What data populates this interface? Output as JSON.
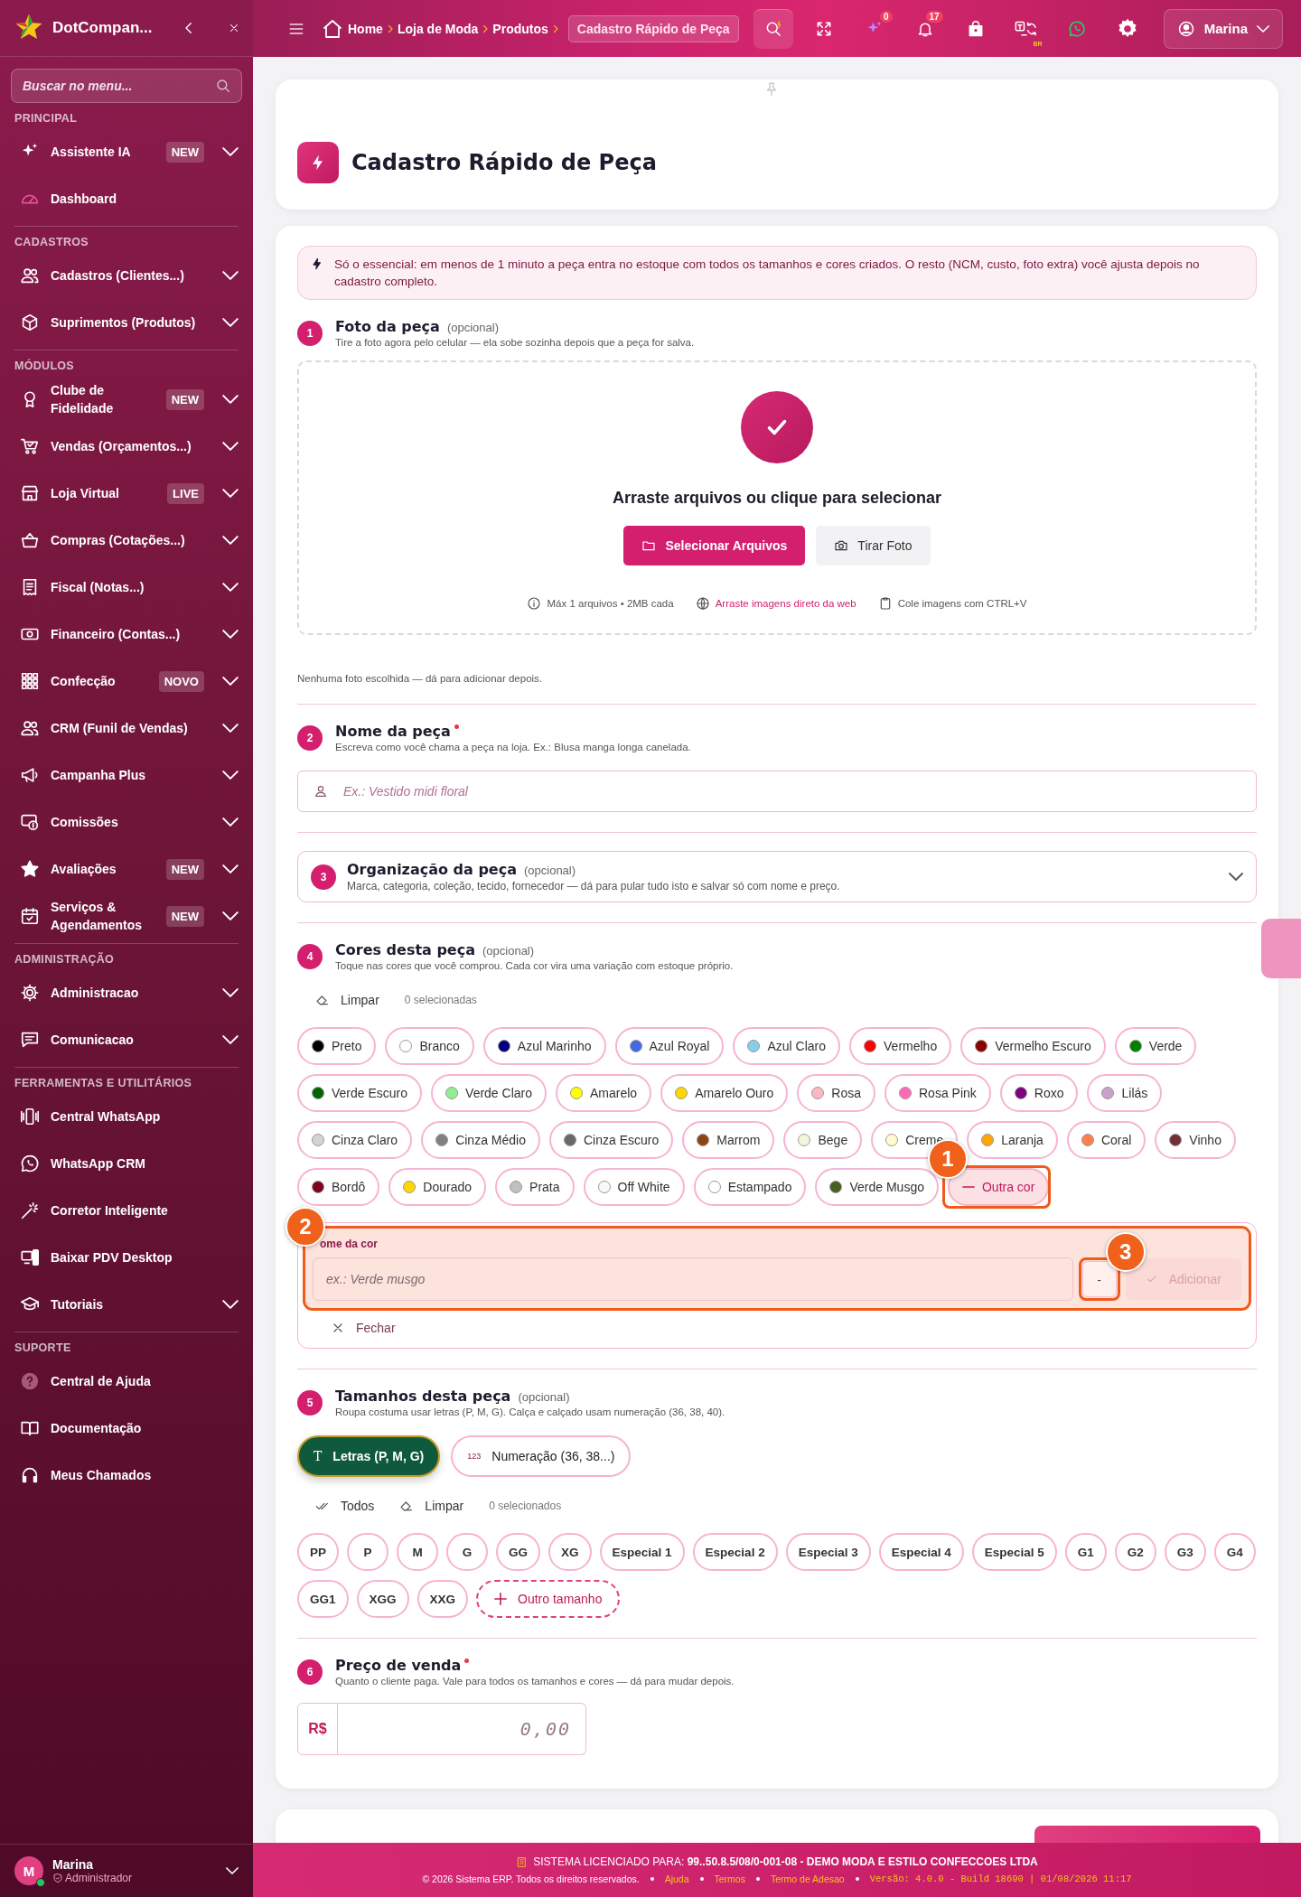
{
  "sidebar": {
    "brand": "DotCompan...",
    "search": {
      "placeholder": "Buscar no menu..."
    },
    "sections": [
      {
        "title": "PRINCIPAL",
        "items": [
          {
            "label": "Assistente IA",
            "badge": "NEW",
            "expandable": true
          },
          {
            "label": "Dashboard",
            "expandable": false
          }
        ]
      },
      {
        "title": "CADASTROS",
        "items": [
          {
            "label": "Cadastros (Clientes...)",
            "expandable": true
          },
          {
            "label": "Suprimentos (Produtos)",
            "expandable": true
          }
        ]
      },
      {
        "title": "MÓDULOS",
        "items": [
          {
            "label": "Clube de Fidelidade",
            "badge": "NEW",
            "expandable": true
          },
          {
            "label": "Vendas (Orçamentos...)",
            "expandable": true
          },
          {
            "label": "Loja Virtual",
            "badge": "LIVE",
            "expandable": true
          },
          {
            "label": "Compras (Cotações...)",
            "expandable": true
          },
          {
            "label": "Fiscal (Notas...)",
            "expandable": true
          },
          {
            "label": "Financeiro (Contas...)",
            "expandable": true
          },
          {
            "label": "Confecção",
            "badge": "NOVO",
            "expandable": true
          },
          {
            "label": "CRM (Funil de Vendas)",
            "expandable": true
          },
          {
            "label": "Campanha Plus",
            "expandable": true
          },
          {
            "label": "Comissões",
            "expandable": true
          },
          {
            "label": "Avaliações",
            "badge": "NEW",
            "expandable": true
          },
          {
            "label": "Serviços & Agendamentos",
            "badge": "NEW",
            "expandable": true
          }
        ]
      },
      {
        "title": "ADMINISTRAÇÃO",
        "items": [
          {
            "label": "Administracao",
            "expandable": true
          },
          {
            "label": "Comunicacao",
            "expandable": true
          }
        ]
      },
      {
        "title": "FERRAMENTAS E UTILITÁRIOS",
        "items": [
          {
            "label": "Central WhatsApp",
            "expandable": false
          },
          {
            "label": "WhatsApp CRM",
            "expandable": false
          },
          {
            "label": "Corretor Inteligente",
            "expandable": false
          },
          {
            "label": "Baixar PDV Desktop",
            "expandable": false
          },
          {
            "label": "Tutoriais",
            "expandable": true
          }
        ]
      },
      {
        "title": "SUPORTE",
        "items": [
          {
            "label": "Central de Ajuda",
            "expandable": false
          },
          {
            "label": "Documentação",
            "expandable": false
          },
          {
            "label": "Meus Chamados",
            "expandable": false
          }
        ]
      }
    ],
    "user": {
      "initial": "M",
      "name": "Marina",
      "role": "Administrador",
      "online": true
    }
  },
  "topbar": {
    "breadcrumb": [
      {
        "label": "Home",
        "current": false
      },
      {
        "label": "Loja de Moda",
        "current": false
      },
      {
        "label": "Produtos",
        "current": false
      },
      {
        "label": "Cadastro Rápido de Peça",
        "current": true
      }
    ],
    "tools": [
      {
        "kind": "search"
      },
      {
        "kind": "expand"
      },
      {
        "kind": "ai",
        "badge": "0"
      },
      {
        "kind": "bell",
        "badge": "17"
      },
      {
        "kind": "bag"
      },
      {
        "kind": "translate",
        "tag": "BR"
      },
      {
        "kind": "whatsapp"
      },
      {
        "kind": "settings"
      }
    ],
    "user": "Marina"
  },
  "page": {
    "title": "Cadastro Rápido de Peça"
  },
  "form": {
    "notice": "Só o essencial: em menos de 1 minuto a peça entra no estoque com todos os tamanhos e cores criados. O resto (NCM, custo, foto extra) você ajusta depois no cadastro completo.",
    "steps": [
      {
        "kind": "photo",
        "number": "1",
        "title": "Foto da peça",
        "note": "(opcional)",
        "description": "Tire a foto agora pelo celular — ela sobe sozinha depois que a peça for salva.",
        "drop_text": "Arraste arquivos ou clique para selecionar",
        "select_button": "Selecionar Arquivos",
        "camera_button": "Tirar Foto",
        "hints": [
          {
            "kind": "info",
            "text": "Máx 1 arquivos • 2MB cada"
          },
          {
            "kind": "web",
            "text": "Arraste imagens direto da web"
          },
          {
            "kind": "clipboard",
            "text": "Cole imagens com CTRL+V"
          }
        ],
        "status": "Nenhuma foto escolhida — dá para adicionar depois."
      },
      {
        "kind": "name",
        "number": "2",
        "title": "Nome da peça",
        "required": true,
        "description": "Escreva como você chama a peça na loja. Ex.: Blusa manga longa canelada.",
        "placeholder": "Ex.: Vestido midi floral"
      },
      {
        "kind": "organization",
        "number": "3",
        "title": "Organização da peça",
        "note": "(opcional)",
        "description": "Marca, categoria, coleção, tecido, fornecedor — dá para pular tudo isto e salvar só com nome e preço.",
        "expanded": false
      },
      {
        "kind": "colors",
        "number": "4",
        "title": "Cores desta peça",
        "note": "(opcional)",
        "description": "Toque nas cores que você comprou. Cada cor vira uma variação com estoque próprio.",
        "clear": "Limpar",
        "count": "0 selecionadas",
        "colors": [
          {
            "name": "Preto",
            "color": "#000000",
            "selected": false
          },
          {
            "name": "Branco",
            "color": "#ffffff",
            "selected": false
          },
          {
            "name": "Azul Marinho",
            "color": "#000080",
            "selected": false
          },
          {
            "name": "Azul Royal",
            "color": "#4169e1",
            "selected": false
          },
          {
            "name": "Azul Claro",
            "color": "#87ceeb",
            "selected": false
          },
          {
            "name": "Vermelho",
            "color": "#ff0000",
            "selected": false
          },
          {
            "name": "Vermelho Escuro",
            "color": "#8b0000",
            "selected": false
          },
          {
            "name": "Verde",
            "color": "#008000",
            "selected": false
          },
          {
            "name": "Verde Escuro",
            "color": "#006400",
            "selected": false
          },
          {
            "name": "Verde Claro",
            "color": "#90ee90",
            "selected": false
          },
          {
            "name": "Amarelo",
            "color": "#ffff00",
            "selected": false
          },
          {
            "name": "Amarelo Ouro",
            "color": "#ffd700",
            "selected": false
          },
          {
            "name": "Rosa",
            "color": "#ffb6c1",
            "selected": false
          },
          {
            "name": "Rosa Pink",
            "color": "#ff69b4",
            "selected": false
          },
          {
            "name": "Roxo",
            "color": "#800080",
            "selected": false
          },
          {
            "name": "Lilás",
            "color": "#c8a2c8",
            "selected": false
          },
          {
            "name": "Cinza Claro",
            "color": "#d3d3d3",
            "selected": false
          },
          {
            "name": "Cinza Médio",
            "color": "#808080",
            "selected": false
          },
          {
            "name": "Cinza Escuro",
            "color": "#696969",
            "selected": false
          },
          {
            "name": "Marrom",
            "color": "#8b4513",
            "selected": false
          },
          {
            "name": "Bege",
            "color": "#f5f5dc",
            "selected": false
          },
          {
            "name": "Creme",
            "color": "#fffdd0",
            "selected": false
          },
          {
            "name": "Laranja",
            "color": "#ffa500",
            "selected": false
          },
          {
            "name": "Coral",
            "color": "#ff7f50",
            "selected": false
          },
          {
            "name": "Vinho",
            "color": "#722f37",
            "selected": false
          },
          {
            "name": "Bordô",
            "color": "#800020",
            "selected": false
          },
          {
            "name": "Dourado",
            "color": "#ffd700",
            "selected": false
          },
          {
            "name": "Prata",
            "color": "#c0c0c0",
            "selected": false
          },
          {
            "name": "Off White",
            "color": "#faf9f6",
            "selected": false
          },
          {
            "name": "Estampado",
            "color": "#ffffff",
            "selected": false
          },
          {
            "name": "Verde Musgo",
            "color": "#4a5d23",
            "selected": false
          }
        ],
        "other": {
          "label": "Outra cor",
          "expanded": true,
          "callout": "1"
        },
        "custom": {
          "label": "ome da cor",
          "callout": "2",
          "placeholder": "ex.: Verde musgo",
          "unit": "-",
          "unit_callout": "3",
          "add": "Adicionar",
          "add_disabled": true,
          "close": "Fechar"
        }
      },
      {
        "kind": "sizes",
        "number": "5",
        "title": "Tamanhos desta peça",
        "note": "(opcional)",
        "description": "Roupa costuma usar letras (P, M, G). Calça e calçado usam numeração (36, 38, 40).",
        "modes": [
          {
            "glyph": "T",
            "label": "Letras (P, M, G)",
            "selected": true
          },
          {
            "glyph": "123",
            "label": "Numeração (36, 38...)",
            "selected": false
          }
        ],
        "all": "Todos",
        "clear": "Limpar",
        "count": "0 selecionados",
        "sizes": [
          {
            "label": "PP",
            "selected": false
          },
          {
            "label": "P",
            "selected": false
          },
          {
            "label": "M",
            "selected": false
          },
          {
            "label": "G",
            "selected": false
          },
          {
            "label": "GG",
            "selected": false
          },
          {
            "label": "XG",
            "selected": false
          },
          {
            "label": "Especial 1",
            "selected": false
          },
          {
            "label": "Especial 2",
            "selected": false
          },
          {
            "label": "Especial 3",
            "selected": false
          },
          {
            "label": "Especial 4",
            "selected": false
          },
          {
            "label": "Especial 5",
            "selected": false
          },
          {
            "label": "G1",
            "selected": false
          },
          {
            "label": "G2",
            "selected": false
          },
          {
            "label": "G3",
            "selected": false
          },
          {
            "label": "G4",
            "selected": false
          },
          {
            "label": "GG1",
            "selected": false
          },
          {
            "label": "XGG",
            "selected": false
          },
          {
            "label": "XXG",
            "selected": false
          }
        ],
        "other": "Outro tamanho"
      },
      {
        "kind": "price",
        "number": "6",
        "title": "Preço de venda",
        "required": true,
        "description": "Quanto o cliente paga. Vale para todos os tamanhos e cores — dá para mudar depois.",
        "currency": "R$",
        "placeholder": "0,00"
      }
    ]
  },
  "footer": {
    "license": "SISTEMA LICENCIADO PARA: **99..50.8.5/08/0-001-08 - DEMO MODA E ESTILO CONFECCOES LTDA**",
    "copyright": "© 2026 Sistema ERP. Todos os direitos reservados.",
    "links": [
      "Ajuda",
      "Termos",
      "Termo de Adesao"
    ],
    "version": "Versão: 4.0.0 - Build 18690 | 01/08/2026 11:17"
  }
}
